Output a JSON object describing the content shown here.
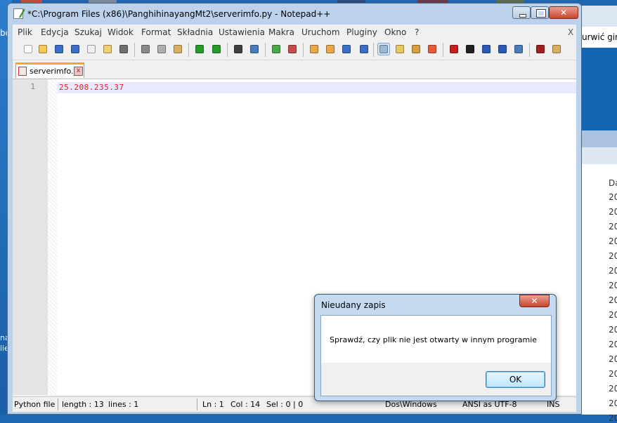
{
  "desktop": {
    "left_text_top": "bo",
    "left_text_bottom": [
      "na",
      "lie"
    ],
    "right_window": {
      "menu_text": "urwić gim",
      "list_header": "Da",
      "list_rows": [
        "20",
        "20",
        "20",
        "20",
        "20",
        "20",
        "20",
        "20",
        "20",
        "20",
        "20",
        "20",
        "20",
        "20",
        "20",
        "20"
      ]
    }
  },
  "window": {
    "title": "*C:\\Program Files (x86)\\PanghihinayangMt2\\serverimfo.py - Notepad++",
    "min_glyph": "",
    "max_glyph": "",
    "close_glyph": "✕"
  },
  "menu": {
    "items": [
      "Plik",
      "Edycja",
      "Szukaj",
      "Widok",
      "Format",
      "Składnia",
      "Ustawienia",
      "Makra",
      "Uruchom",
      "Pluginy",
      "Okno",
      "?"
    ],
    "close": "X"
  },
  "toolbar": {
    "icons": [
      "new-file-icon",
      "open-file-icon",
      "save-icon",
      "save-all-icon",
      "close-icon",
      "close-all-icon",
      "print-icon",
      "cut-icon",
      "copy-icon",
      "paste-icon",
      "undo-icon",
      "redo-icon",
      "find-icon",
      "replace-icon",
      "zoom-in-icon",
      "zoom-out-icon",
      "sync-vertical-icon",
      "sync-horizontal-icon",
      "word-wrap-icon",
      "show-all-chars-icon",
      "indent-guide-icon",
      "doc-map-icon",
      "function-list-icon",
      "folder-workspace-icon",
      "record-macro-icon",
      "stop-macro-icon",
      "play-macro-icon",
      "run-macro-multiple-icon",
      "save-macro-icon",
      "spell-check-icon",
      "spell-options-icon"
    ]
  },
  "tab": {
    "label": "serverimfo.py",
    "close": "x"
  },
  "editor": {
    "line_number": "1",
    "line_text": "25.208.235.37"
  },
  "status": {
    "file_type": "Python file",
    "length": "length : 13",
    "lines": "lines : 1",
    "ln": "Ln : 1",
    "col": "Col : 14",
    "sel": "Sel : 0 | 0",
    "eol": "Dos\\Windows",
    "encoding": "ANSI as UTF-8",
    "mode": "INS"
  },
  "dialog": {
    "title": "Nieudany zapis",
    "close": "✕",
    "message": "Sprawdź, czy plik nie jest otwarty w innym programie",
    "ok": "OK"
  }
}
